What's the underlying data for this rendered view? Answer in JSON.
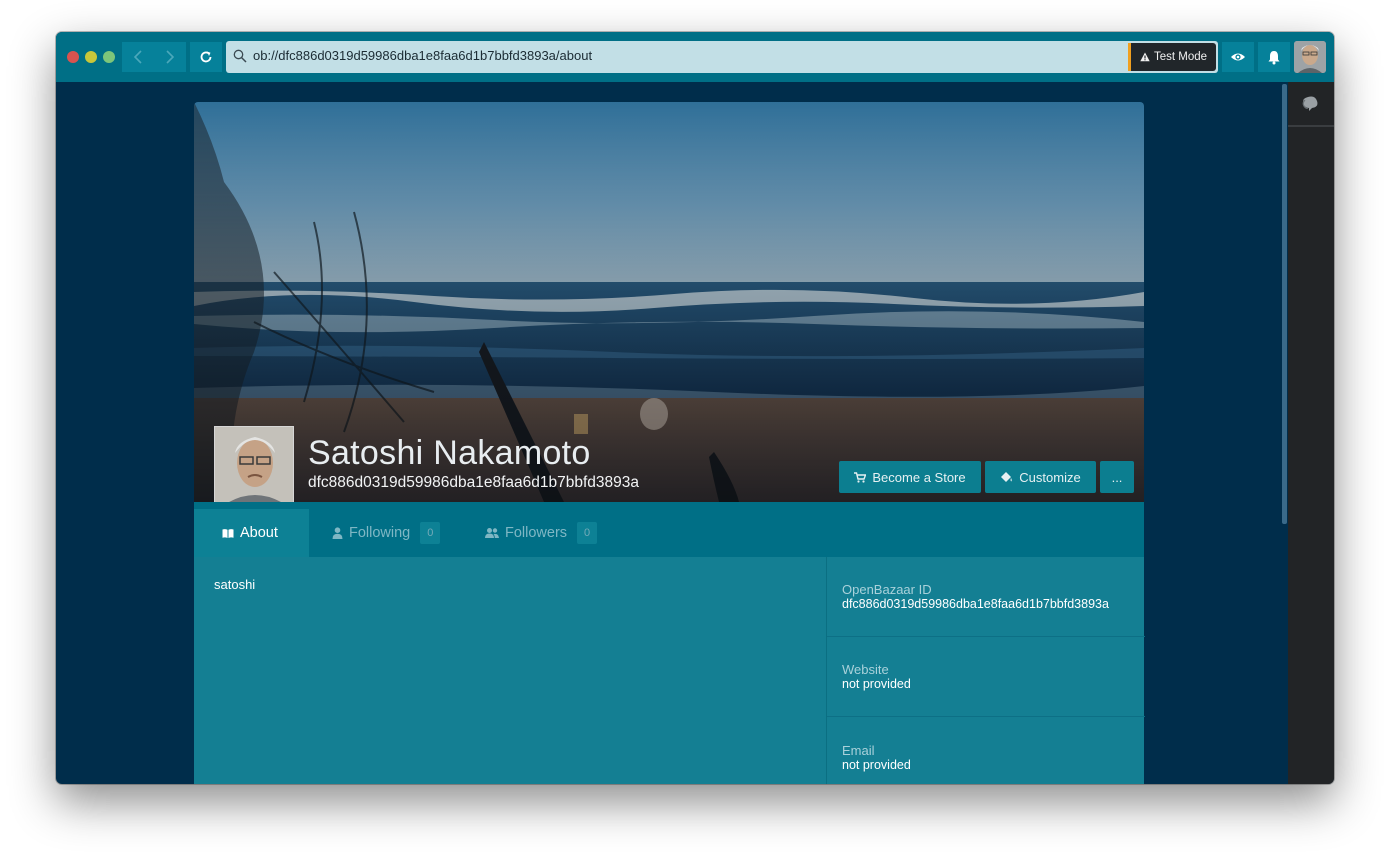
{
  "browser": {
    "address": "ob://dfc886d0319d59986dba1e8faa6d1b7bbfd3893a/about",
    "test_mode_label": "Test Mode"
  },
  "profile": {
    "name": "Satoshi Nakamoto",
    "peer_id": "dfc886d0319d59986dba1e8faa6d1b7bbfd3893a",
    "become_store_label": "Become a Store",
    "customize_label": "Customize",
    "more_label": "..."
  },
  "tabs": [
    {
      "label": "About"
    },
    {
      "label": "Following",
      "count": "0"
    },
    {
      "label": "Followers",
      "count": "0"
    }
  ],
  "about": {
    "text": "satoshi"
  },
  "details": {
    "openbazaar_id_label": "OpenBazaar ID",
    "openbazaar_id_value": "dfc886d0319d59986dba1e8faa6d1b7bbfd3893a",
    "website_label": "Website",
    "website_value": "not provided",
    "email_label": "Email",
    "email_value": "not provided"
  },
  "colors": {
    "topbar": "#006f86",
    "page_background": "#002d4b",
    "panel": "#147f93",
    "test_mode_accent": "#f0a020"
  }
}
